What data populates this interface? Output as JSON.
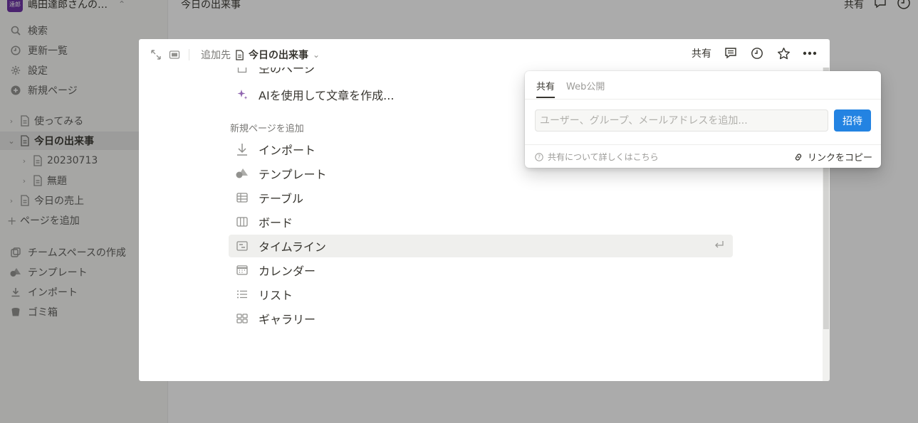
{
  "sidebar": {
    "workspace_name": "嶋田達郎さんの…",
    "workspace_avatar": "達郎",
    "nav": [
      {
        "label": "検索",
        "icon": "search-icon"
      },
      {
        "label": "更新一覧",
        "icon": "clock-icon"
      },
      {
        "label": "設定",
        "icon": "gear-icon"
      },
      {
        "label": "新規ページ",
        "icon": "plus-circle-icon"
      }
    ],
    "tree": [
      {
        "label": "使ってみる"
      },
      {
        "label": "今日の出来事"
      },
      {
        "label": "20230713"
      },
      {
        "label": "無題"
      },
      {
        "label": "今日の売上"
      }
    ],
    "add_page": "ページを追加",
    "bottom": [
      {
        "label": "チームスペースの作成"
      },
      {
        "label": "テンプレート"
      },
      {
        "label": "インポート"
      },
      {
        "label": "ゴミ箱"
      }
    ]
  },
  "topbar": {
    "title": "今日の出来事",
    "share": "共有"
  },
  "modal": {
    "breadcrumb_prefix": "追加先",
    "page_name": "今日の出来事",
    "share_label": "共有",
    "partial_item": "空のページ",
    "ai_item": "AIを使用して文章を作成...",
    "section_label": "新規ページを追加",
    "items": [
      {
        "label": "インポート"
      },
      {
        "label": "テンプレート"
      },
      {
        "label": "テーブル"
      },
      {
        "label": "ボード"
      },
      {
        "label": "タイムライン"
      },
      {
        "label": "カレンダー"
      },
      {
        "label": "リスト"
      },
      {
        "label": "ギャラリー"
      }
    ],
    "highlighted_index": 4
  },
  "share_popover": {
    "tabs": [
      "共有",
      "Web公開"
    ],
    "input_placeholder": "ユーザー、グループ、メールアドレスを追加...",
    "invite_button": "招待",
    "learn_more": "共有について詳しくはこちら",
    "copy_link": "リンクをコピー"
  },
  "colors": {
    "accent": "#2383e2",
    "ai_purple": "#9065b0",
    "avatar": "#6b2fa3"
  }
}
